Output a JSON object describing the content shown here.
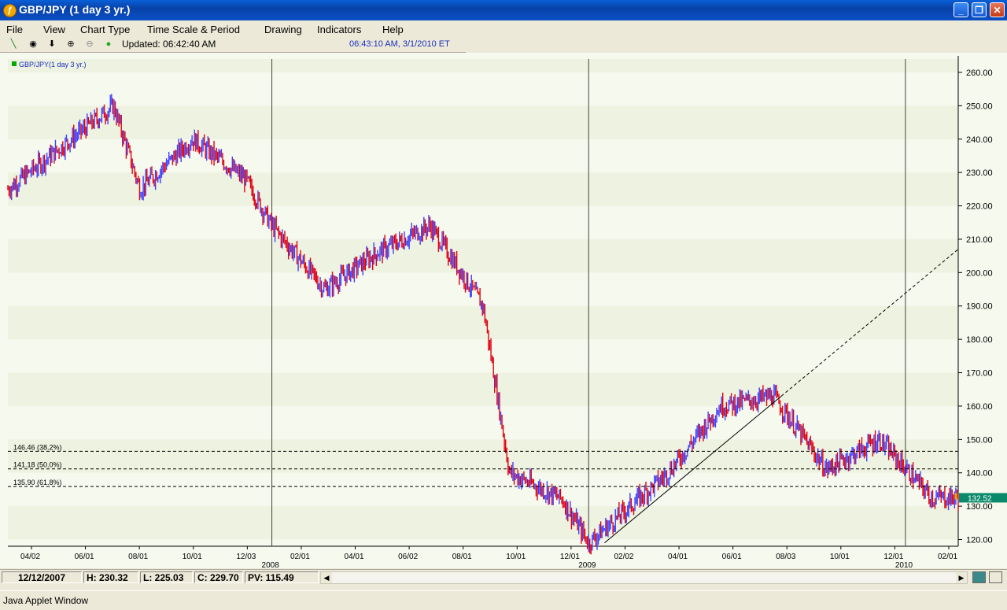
{
  "window": {
    "title": "GBP/JPY (1 day  3 yr.)"
  },
  "menu": [
    "File",
    "View",
    "Chart Type",
    "Time Scale & Period",
    "Drawing",
    "Indicators",
    "Help"
  ],
  "toolbar": {
    "updated": "Updated: 06:42:40 AM",
    "server_time": "06:43:10 AM, 3/1/2010 ET"
  },
  "chart_data": {
    "type": "candlestick",
    "title": "GBP/JPY(1 day  3 yr.)",
    "ylim": [
      118,
      264
    ],
    "yticks": [
      "260.00",
      "250.00",
      "240.00",
      "230.00",
      "220.00",
      "210.00",
      "200.00",
      "190.00",
      "180.00",
      "170.00",
      "160.00",
      "150.00",
      "140.00",
      "130.00",
      "120.00"
    ],
    "xticks": [
      "04/02",
      "06/01",
      "08/01",
      "10/01",
      "12/03",
      "02/01",
      "04/01",
      "06/02",
      "08/01",
      "10/01",
      "12/01",
      "02/02",
      "04/01",
      "06/01",
      "08/03",
      "10/01",
      "12/01",
      "02/01"
    ],
    "year_labels": [
      "2008",
      "2009",
      "2010"
    ],
    "fib_levels": [
      {
        "label": "146.46 (38.2%)",
        "value": 146.46
      },
      {
        "label": "141.18 (50.0%)",
        "value": 141.18
      },
      {
        "label": "135.90 (61.8%)",
        "value": 135.9
      }
    ],
    "last_price": "132.52",
    "colors": {
      "up": "#4040ff",
      "down": "#e00010",
      "background": "#f6f9ee",
      "band": "#eef2e0",
      "last": "#0a8a6a"
    },
    "key_points": [
      {
        "date": "03/2007",
        "value": 225
      },
      {
        "date": "07/2007",
        "value": 250
      },
      {
        "date": "08/2007",
        "value": 225
      },
      {
        "date": "10/2007",
        "value": 240
      },
      {
        "date": "12/2007",
        "value": 228
      },
      {
        "date": "01/2008",
        "value": 214
      },
      {
        "date": "03/2008",
        "value": 195
      },
      {
        "date": "05/2008",
        "value": 206
      },
      {
        "date": "07/2008",
        "value": 214
      },
      {
        "date": "09/2008",
        "value": 190
      },
      {
        "date": "10/2008",
        "value": 140
      },
      {
        "date": "12/2008",
        "value": 132
      },
      {
        "date": "01/2009",
        "value": 119
      },
      {
        "date": "04/2009",
        "value": 140
      },
      {
        "date": "06/2009",
        "value": 160
      },
      {
        "date": "08/2009",
        "value": 163
      },
      {
        "date": "10/2009",
        "value": 141
      },
      {
        "date": "12/2009",
        "value": 150
      },
      {
        "date": "02/2010",
        "value": 132.52
      }
    ]
  },
  "status": {
    "date": "12/12/2007",
    "high": "H: 230.32",
    "low": "L: 225.03",
    "close": "C: 229.70",
    "pv": "PV: 115.49"
  },
  "bottom": {
    "label": "Java Applet Window"
  }
}
